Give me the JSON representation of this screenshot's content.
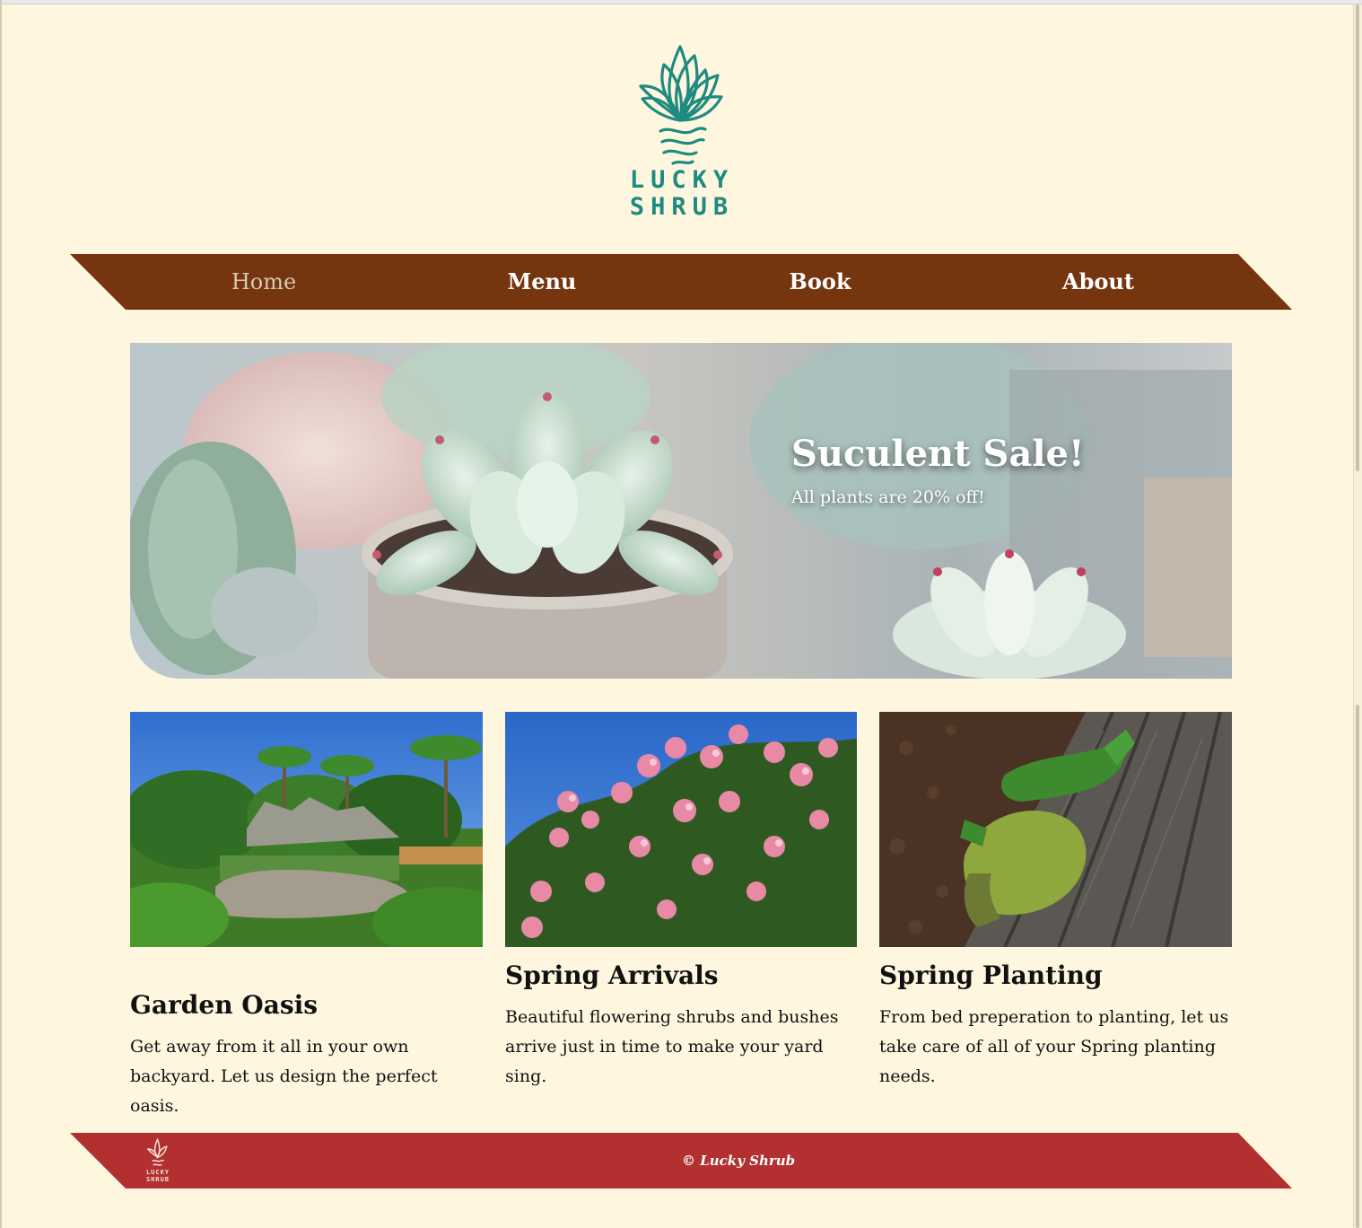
{
  "brand": {
    "logo_line1": "LUCKY",
    "logo_line2": "SHRUB",
    "logo_color": "#1f8a80"
  },
  "nav": {
    "items": [
      {
        "label": "Home",
        "active": true
      },
      {
        "label": "Menu",
        "active": false
      },
      {
        "label": "Book",
        "active": false
      },
      {
        "label": "About",
        "active": false
      }
    ],
    "background": "#75350f"
  },
  "hero": {
    "title": "Suculent Sale!",
    "subtitle": "All plants are 20% off!",
    "image": "succulent-pots-photo"
  },
  "cards": [
    {
      "title": "Garden Oasis",
      "text": "Get away from it all in your own backyard. Let us design the perfect oasis.",
      "image": "tropical-garden-photo"
    },
    {
      "title": "Spring Arrivals",
      "text": "Beautiful flowering shrubs and bushes arrive just in time to make your yard sing.",
      "image": "pink-oleander-flowers-photo"
    },
    {
      "title": "Spring Planting",
      "text": "From bed preperation to planting, let us take care of all of your Spring planting needs.",
      "image": "garden-gloves-photo"
    }
  ],
  "footer": {
    "logo_line1": "LUCKY",
    "logo_line2": "SHRUB",
    "copyright": "© Lucky Shrub",
    "background": "#b23030"
  },
  "page": {
    "background": "#fef6de"
  }
}
